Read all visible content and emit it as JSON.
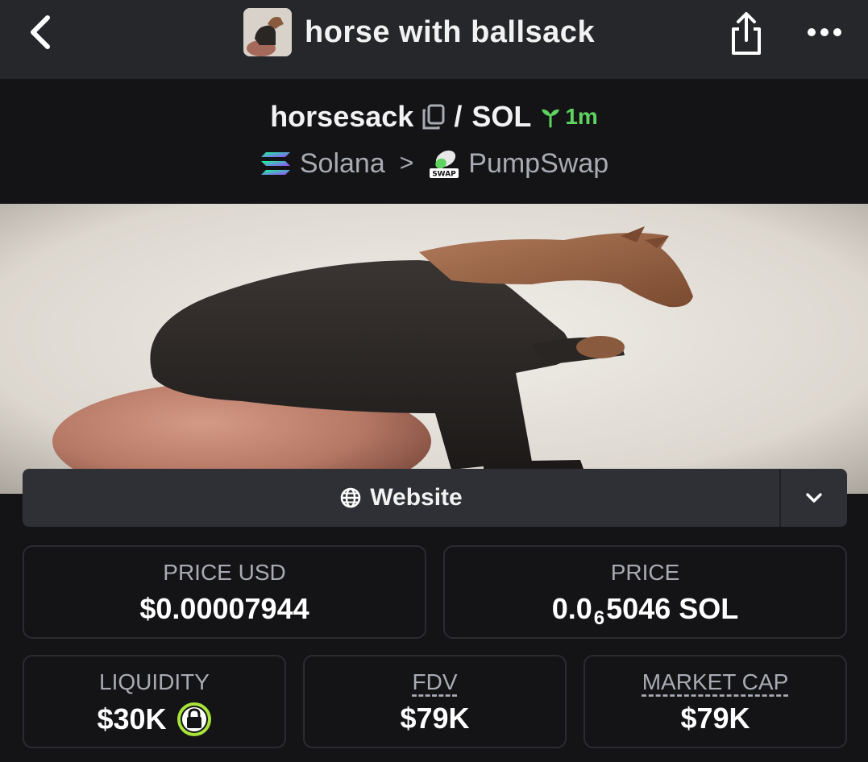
{
  "header": {
    "title": "horse with ballsack",
    "back_icon": "chevron-left-icon",
    "share_icon": "share-icon",
    "more_icon": "more-dots-icon"
  },
  "pair": {
    "base_symbol": "horsesack",
    "separator": "/",
    "quote_symbol": "SOL",
    "age": "1m",
    "chain": "Solana",
    "chain_separator": ">",
    "dex": "PumpSwap",
    "dex_badge": "SWAP"
  },
  "links": {
    "website_label": "Website"
  },
  "stats": {
    "price_usd_label": "PRICE USD",
    "price_usd_value": "$0.00007944",
    "price_label": "PRICE",
    "price_value_prefix": "0.0",
    "price_value_subscript": "6",
    "price_value_suffix": "5046 SOL",
    "liquidity_label": "LIQUIDITY",
    "liquidity_value": "$30K",
    "fdv_label": "FDV",
    "fdv_value": "$79K",
    "market_cap_label": "MARKET CAP",
    "market_cap_value": "$79K"
  },
  "colors": {
    "background": "#141417",
    "topbar": "#26272b",
    "accent_green": "#5fd35f",
    "muted_text": "#a9abb3"
  }
}
